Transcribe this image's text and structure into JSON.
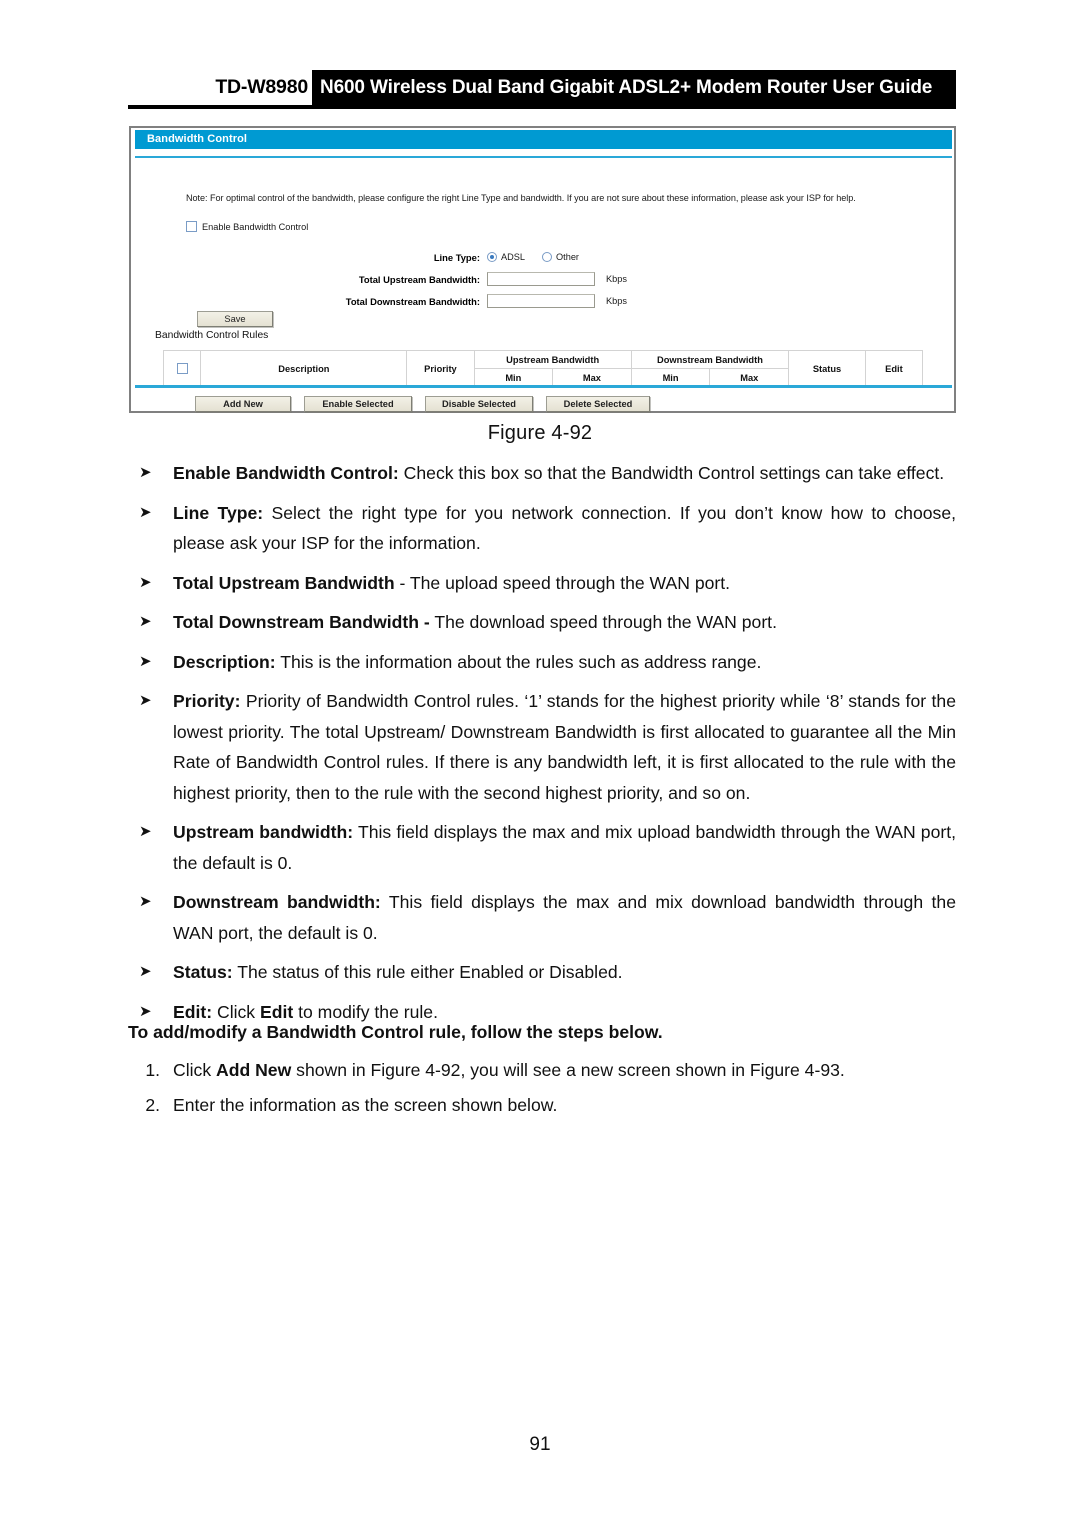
{
  "header": {
    "model": "TD-W8980",
    "title": "N600 Wireless Dual Band Gigabit ADSL2+ Modem Router User Guide"
  },
  "screenshot": {
    "titlebar": "Bandwidth Control",
    "note": "Note: For optimal control of the bandwidth, please configure the right Line Type and bandwidth. If you are not sure about these information, please ask your ISP for help.",
    "enable_checkbox_label": "Enable Bandwidth Control",
    "enable_checkbox_checked": false,
    "form": {
      "line_type_label": "Line Type:",
      "line_type_options": [
        "ADSL",
        "Other"
      ],
      "line_type_selected": "ADSL",
      "upstream_label": "Total Upstream Bandwidth:",
      "upstream_value": "",
      "upstream_unit": "Kbps",
      "downstream_label": "Total Downstream Bandwidth:",
      "downstream_value": "",
      "downstream_unit": "Kbps"
    },
    "save_button": "Save",
    "rules_title": "Bandwidth Control Rules",
    "table": {
      "headers": {
        "description": "Description",
        "priority": "Priority",
        "upstream_group": "Upstream Bandwidth",
        "downstream_group": "Downstream Bandwidth",
        "min": "Min",
        "max": "Max",
        "status": "Status",
        "edit": "Edit"
      },
      "rows": []
    },
    "actions": {
      "add_new": "Add New",
      "enable_selected": "Enable Selected",
      "disable_selected": "Disable Selected",
      "delete_selected": "Delete Selected"
    },
    "accent_color": "#009ad2",
    "divider_color": "#2aa8d8"
  },
  "figure_caption": "Figure 4-92",
  "bullets": [
    {
      "term": "Enable Bandwidth Control:",
      "text": " Check this box so that the Bandwidth Control settings can take effect."
    },
    {
      "term": "Line Type:",
      "text": " Select the right type for you network connection. If you don’t know how to choose, please ask your ISP for the information."
    },
    {
      "term": "Total Upstream Bandwidth",
      "text": " - The upload speed through the WAN port."
    },
    {
      "term": "Total Downstream Bandwidth -",
      "text": " The download speed through the WAN port."
    },
    {
      "term": "Description:",
      "text": " This is the information about the rules such as address range."
    },
    {
      "term": "Priority:",
      "text": " Priority of Bandwidth Control rules. ‘1’ stands for the highest priority while ‘8’ stands for the lowest priority. The total Upstream/ Downstream Bandwidth is first allocated to guarantee all the Min Rate of Bandwidth Control rules. If there is any bandwidth left, it is first allocated to the rule with the highest priority, then to the rule with the second highest priority, and so on."
    },
    {
      "term": "Upstream bandwidth:",
      "text": " This field displays the max and mix upload bandwidth through the WAN port, the default is 0."
    },
    {
      "term": "Downstream bandwidth:",
      "text": " This field displays the max and mix download bandwidth through the WAN port, the default is 0."
    },
    {
      "term": "Status:",
      "text": " The status of this rule either Enabled or Disabled."
    },
    {
      "term": "Edit:",
      "text": " Click Edit to modify the rule."
    }
  ],
  "steps_heading": "To add/modify a Bandwidth Control rule, follow the steps below.",
  "steps": [
    {
      "num": "1.",
      "text": "Click Add New shown in Figure 4-92, you will see a new screen shown in Figure 4-93."
    },
    {
      "num": "2.",
      "text": "Enter the information as the screen shown below."
    }
  ],
  "page_number": "91"
}
